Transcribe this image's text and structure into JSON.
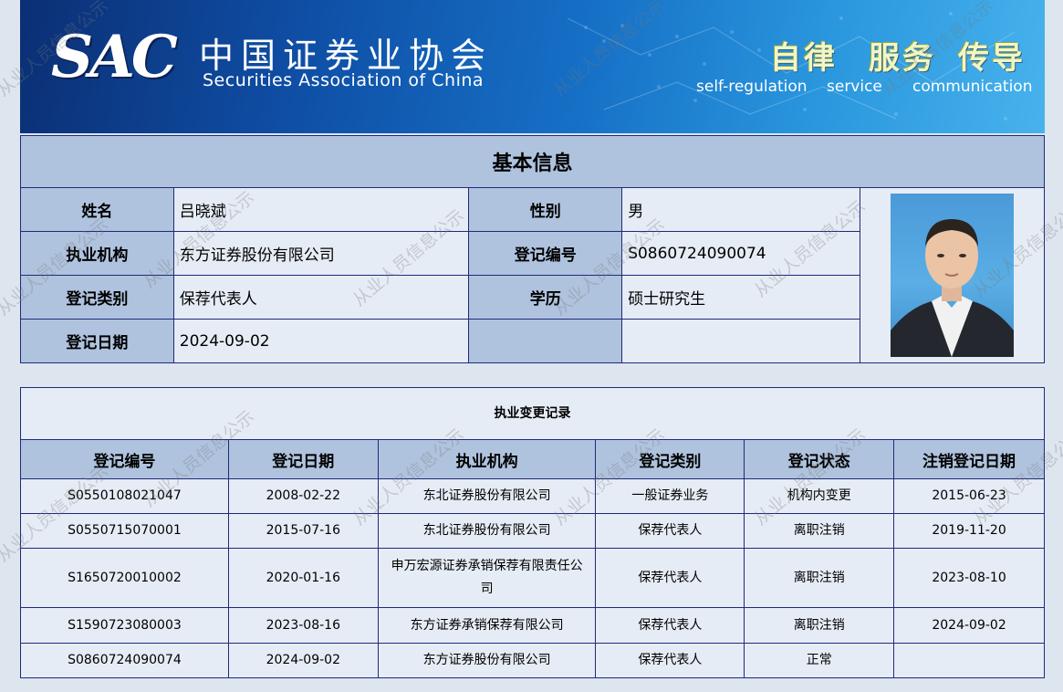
{
  "header": {
    "logo_mark": "SAC",
    "name_cn": "中国证券业协会",
    "name_en": "Securities Association of China",
    "slogans": [
      {
        "cn": "自律",
        "en": "self-regulation"
      },
      {
        "cn": "服务",
        "en": "service"
      },
      {
        "cn": "传导",
        "en": "communication"
      }
    ]
  },
  "basic_info": {
    "title": "基本信息",
    "name_label": "姓名",
    "name": "吕晓斌",
    "gender_label": "性别",
    "gender": "男",
    "org_label": "执业机构",
    "org": "东方证券股份有限公司",
    "reg_no_label": "登记编号",
    "reg_no": "S0860724090074",
    "reg_type_label": "登记类别",
    "reg_type": "保荐代表人",
    "edu_label": "学历",
    "edu": "硕士研究生",
    "reg_date_label": "登记日期",
    "reg_date": "2024-09-02",
    "photo_icon": "person-photo"
  },
  "change_records": {
    "title": "执业变更记录",
    "columns": [
      "登记编号",
      "登记日期",
      "执业机构",
      "登记类别",
      "登记状态",
      "注销登记日期"
    ],
    "rows": [
      [
        "S0550108021047",
        "2008-02-22",
        "东北证券股份有限公司",
        "一般证券业务",
        "机构内变更",
        "2015-06-23"
      ],
      [
        "S0550715070001",
        "2015-07-16",
        "东北证券股份有限公司",
        "保荐代表人",
        "离职注销",
        "2019-11-20"
      ],
      [
        "S1650720010002",
        "2020-01-16",
        "申万宏源证券承销保荐有限责任公司",
        "保荐代表人",
        "离职注销",
        "2023-08-10"
      ],
      [
        "S1590723080003",
        "2023-08-16",
        "东方证券承销保荐有限公司",
        "保荐代表人",
        "离职注销",
        "2024-09-02"
      ],
      [
        "S0860724090074",
        "2024-09-02",
        "东方证券股份有限公司",
        "保荐代表人",
        "正常",
        ""
      ]
    ]
  },
  "watermark": "从业人员信息公示"
}
